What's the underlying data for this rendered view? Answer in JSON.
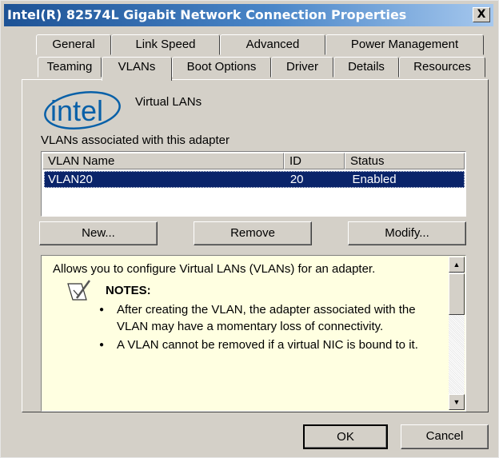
{
  "window": {
    "title": "Intel(R) 82574L Gigabit Network Connection Properties",
    "close_label": "X"
  },
  "tabs_row1": [
    "General",
    "Link Speed",
    "Advanced",
    "Power Management"
  ],
  "tabs_row2": [
    "Teaming",
    "VLANs",
    "Boot Options",
    "Driver",
    "Details",
    "Resources"
  ],
  "active_tab": "VLANs",
  "header": {
    "logo_text": "intel",
    "section_label": "Virtual LANs"
  },
  "vlan_list": {
    "caption": "VLANs associated with this adapter",
    "columns": [
      "VLAN Name",
      "ID",
      "Status"
    ],
    "rows": [
      {
        "name": "VLAN20",
        "id": "20",
        "status": "Enabled"
      }
    ]
  },
  "buttons": {
    "new": "New...",
    "remove": "Remove",
    "modify": "Modify...",
    "ok": "OK",
    "cancel": "Cancel"
  },
  "help": {
    "intro": "Allows you to configure Virtual LANs (VLANs) for an adapter.",
    "notes_title": "NOTES:",
    "notes": [
      "After creating the VLAN, the adapter associated with the VLAN may have a momentary loss of connectivity.",
      "A VLAN cannot be removed if a virtual NIC is bound to it."
    ]
  },
  "colors": {
    "selection": "#0a246a",
    "help_bg": "#ffffe1",
    "dialog_bg": "#d4d0c8",
    "intel_blue": "#0860a8"
  }
}
